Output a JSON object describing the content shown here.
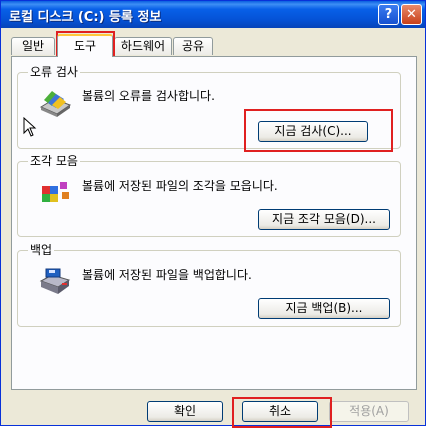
{
  "window": {
    "title": "로컬 디스크 (C:) 등록 정보",
    "help_label": "?",
    "close_label": "✕"
  },
  "tabs": [
    {
      "label": "일반"
    },
    {
      "label": "도구"
    },
    {
      "label": "하드웨어"
    },
    {
      "label": "공유"
    }
  ],
  "error_check": {
    "title": "오류 검사",
    "description": "볼륨의 오류를 검사합니다.",
    "button": "지금 검사(C)..."
  },
  "defrag": {
    "title": "조각 모음",
    "description": "볼륨에 저장된 파일의 조각을 모읍니다.",
    "button": "지금 조각 모음(D)..."
  },
  "backup": {
    "title": "백업",
    "description": "볼륨에 저장된 파일을 백업합니다.",
    "button": "지금 백업(B)..."
  },
  "footer": {
    "ok": "확인",
    "cancel": "취소",
    "apply": "적용(A)"
  },
  "colors": {
    "highlight": "#e02020",
    "titlebar": "#0552d6"
  },
  "icons": [
    "disk-check-icon",
    "defrag-icon",
    "backup-icon",
    "mouse-cursor-icon"
  ]
}
